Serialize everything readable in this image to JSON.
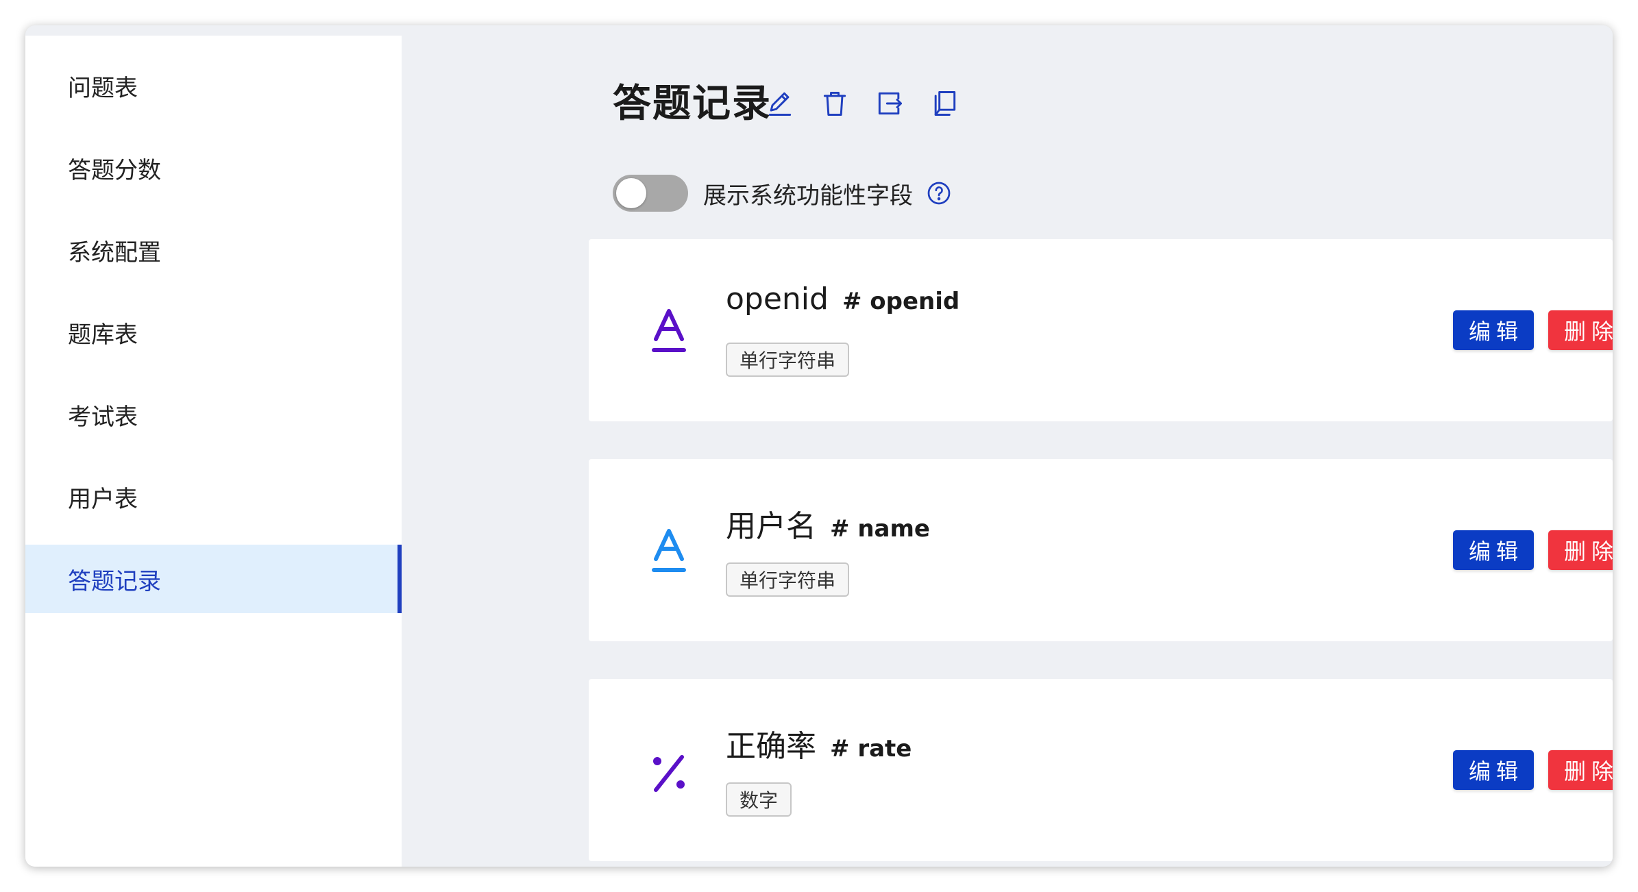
{
  "sidebar": {
    "items": [
      {
        "label": "问题表",
        "active": false
      },
      {
        "label": "答题分数",
        "active": false
      },
      {
        "label": "系统配置",
        "active": false
      },
      {
        "label": "题库表",
        "active": false
      },
      {
        "label": "考试表",
        "active": false
      },
      {
        "label": "用户表",
        "active": false
      },
      {
        "label": "答题记录",
        "active": true
      }
    ]
  },
  "header": {
    "title": "答题记录",
    "icons": [
      "edit-icon",
      "trash-icon",
      "export-icon",
      "copy-icon"
    ]
  },
  "toggle": {
    "label": "展示系统功能性字段",
    "on": false
  },
  "fields": [
    {
      "name": "openid",
      "key": "# openid",
      "type": "单行字符串",
      "icon": "text-field-icon",
      "icon_color": "#5a10c8"
    },
    {
      "name": "用户名",
      "key": "# name",
      "type": "单行字符串",
      "icon": "text-field-icon",
      "icon_color": "#1e8cf0"
    },
    {
      "name": "正确率",
      "key": "# rate",
      "type": "数字",
      "icon": "percent-icon",
      "icon_color": "#5a10c8"
    }
  ],
  "buttons": {
    "edit": "编辑",
    "delete": "删除"
  },
  "colors": {
    "accent": "#1f3fbf",
    "active_bg": "#e0effd",
    "edit_btn": "#0b3cc4",
    "delete_btn": "#f0343e",
    "background": "#eef0f4"
  }
}
